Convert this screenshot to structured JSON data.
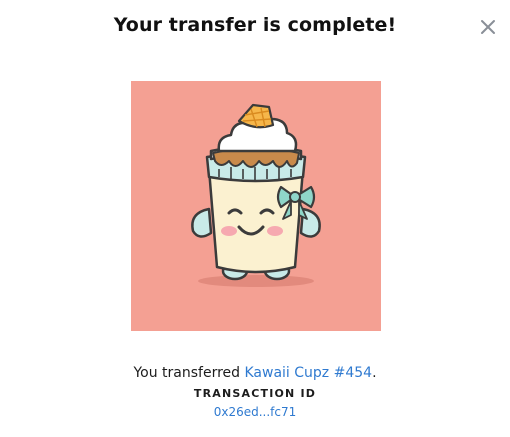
{
  "dialog": {
    "title": "Your transfer is complete!",
    "close_icon": "close-icon"
  },
  "nft": {
    "art_background": "#f4a093",
    "art_subject": "kawaii-cup-icon"
  },
  "summary": {
    "prefix": "You transferred ",
    "item_name": "Kawaii Cupz #454",
    "suffix": "."
  },
  "transaction": {
    "label": "TRANSACTION ID",
    "id": "0x26ed...fc71"
  },
  "colors": {
    "link": "#2f7ad0",
    "title": "#111111"
  }
}
